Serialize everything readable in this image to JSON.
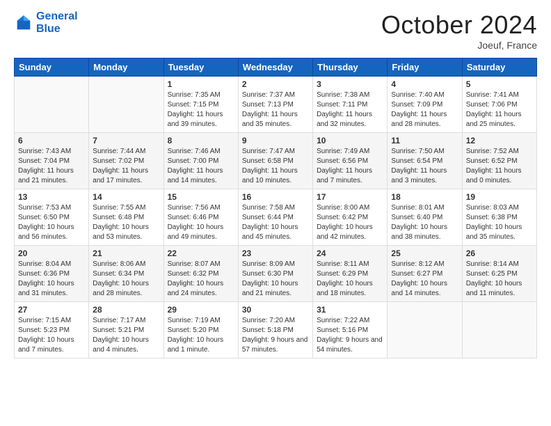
{
  "header": {
    "logo_line1": "General",
    "logo_line2": "Blue",
    "month_title": "October 2024",
    "location": "Joeuf, France"
  },
  "weekdays": [
    "Sunday",
    "Monday",
    "Tuesday",
    "Wednesday",
    "Thursday",
    "Friday",
    "Saturday"
  ],
  "weeks": [
    [
      {
        "day": "",
        "info": ""
      },
      {
        "day": "",
        "info": ""
      },
      {
        "day": "1",
        "info": "Sunrise: 7:35 AM\nSunset: 7:15 PM\nDaylight: 11 hours and 39 minutes."
      },
      {
        "day": "2",
        "info": "Sunrise: 7:37 AM\nSunset: 7:13 PM\nDaylight: 11 hours and 35 minutes."
      },
      {
        "day": "3",
        "info": "Sunrise: 7:38 AM\nSunset: 7:11 PM\nDaylight: 11 hours and 32 minutes."
      },
      {
        "day": "4",
        "info": "Sunrise: 7:40 AM\nSunset: 7:09 PM\nDaylight: 11 hours and 28 minutes."
      },
      {
        "day": "5",
        "info": "Sunrise: 7:41 AM\nSunset: 7:06 PM\nDaylight: 11 hours and 25 minutes."
      }
    ],
    [
      {
        "day": "6",
        "info": "Sunrise: 7:43 AM\nSunset: 7:04 PM\nDaylight: 11 hours and 21 minutes."
      },
      {
        "day": "7",
        "info": "Sunrise: 7:44 AM\nSunset: 7:02 PM\nDaylight: 11 hours and 17 minutes."
      },
      {
        "day": "8",
        "info": "Sunrise: 7:46 AM\nSunset: 7:00 PM\nDaylight: 11 hours and 14 minutes."
      },
      {
        "day": "9",
        "info": "Sunrise: 7:47 AM\nSunset: 6:58 PM\nDaylight: 11 hours and 10 minutes."
      },
      {
        "day": "10",
        "info": "Sunrise: 7:49 AM\nSunset: 6:56 PM\nDaylight: 11 hours and 7 minutes."
      },
      {
        "day": "11",
        "info": "Sunrise: 7:50 AM\nSunset: 6:54 PM\nDaylight: 11 hours and 3 minutes."
      },
      {
        "day": "12",
        "info": "Sunrise: 7:52 AM\nSunset: 6:52 PM\nDaylight: 11 hours and 0 minutes."
      }
    ],
    [
      {
        "day": "13",
        "info": "Sunrise: 7:53 AM\nSunset: 6:50 PM\nDaylight: 10 hours and 56 minutes."
      },
      {
        "day": "14",
        "info": "Sunrise: 7:55 AM\nSunset: 6:48 PM\nDaylight: 10 hours and 53 minutes."
      },
      {
        "day": "15",
        "info": "Sunrise: 7:56 AM\nSunset: 6:46 PM\nDaylight: 10 hours and 49 minutes."
      },
      {
        "day": "16",
        "info": "Sunrise: 7:58 AM\nSunset: 6:44 PM\nDaylight: 10 hours and 45 minutes."
      },
      {
        "day": "17",
        "info": "Sunrise: 8:00 AM\nSunset: 6:42 PM\nDaylight: 10 hours and 42 minutes."
      },
      {
        "day": "18",
        "info": "Sunrise: 8:01 AM\nSunset: 6:40 PM\nDaylight: 10 hours and 38 minutes."
      },
      {
        "day": "19",
        "info": "Sunrise: 8:03 AM\nSunset: 6:38 PM\nDaylight: 10 hours and 35 minutes."
      }
    ],
    [
      {
        "day": "20",
        "info": "Sunrise: 8:04 AM\nSunset: 6:36 PM\nDaylight: 10 hours and 31 minutes."
      },
      {
        "day": "21",
        "info": "Sunrise: 8:06 AM\nSunset: 6:34 PM\nDaylight: 10 hours and 28 minutes."
      },
      {
        "day": "22",
        "info": "Sunrise: 8:07 AM\nSunset: 6:32 PM\nDaylight: 10 hours and 24 minutes."
      },
      {
        "day": "23",
        "info": "Sunrise: 8:09 AM\nSunset: 6:30 PM\nDaylight: 10 hours and 21 minutes."
      },
      {
        "day": "24",
        "info": "Sunrise: 8:11 AM\nSunset: 6:29 PM\nDaylight: 10 hours and 18 minutes."
      },
      {
        "day": "25",
        "info": "Sunrise: 8:12 AM\nSunset: 6:27 PM\nDaylight: 10 hours and 14 minutes."
      },
      {
        "day": "26",
        "info": "Sunrise: 8:14 AM\nSunset: 6:25 PM\nDaylight: 10 hours and 11 minutes."
      }
    ],
    [
      {
        "day": "27",
        "info": "Sunrise: 7:15 AM\nSunset: 5:23 PM\nDaylight: 10 hours and 7 minutes."
      },
      {
        "day": "28",
        "info": "Sunrise: 7:17 AM\nSunset: 5:21 PM\nDaylight: 10 hours and 4 minutes."
      },
      {
        "day": "29",
        "info": "Sunrise: 7:19 AM\nSunset: 5:20 PM\nDaylight: 10 hours and 1 minute."
      },
      {
        "day": "30",
        "info": "Sunrise: 7:20 AM\nSunset: 5:18 PM\nDaylight: 9 hours and 57 minutes."
      },
      {
        "day": "31",
        "info": "Sunrise: 7:22 AM\nSunset: 5:16 PM\nDaylight: 9 hours and 54 minutes."
      },
      {
        "day": "",
        "info": ""
      },
      {
        "day": "",
        "info": ""
      }
    ]
  ]
}
